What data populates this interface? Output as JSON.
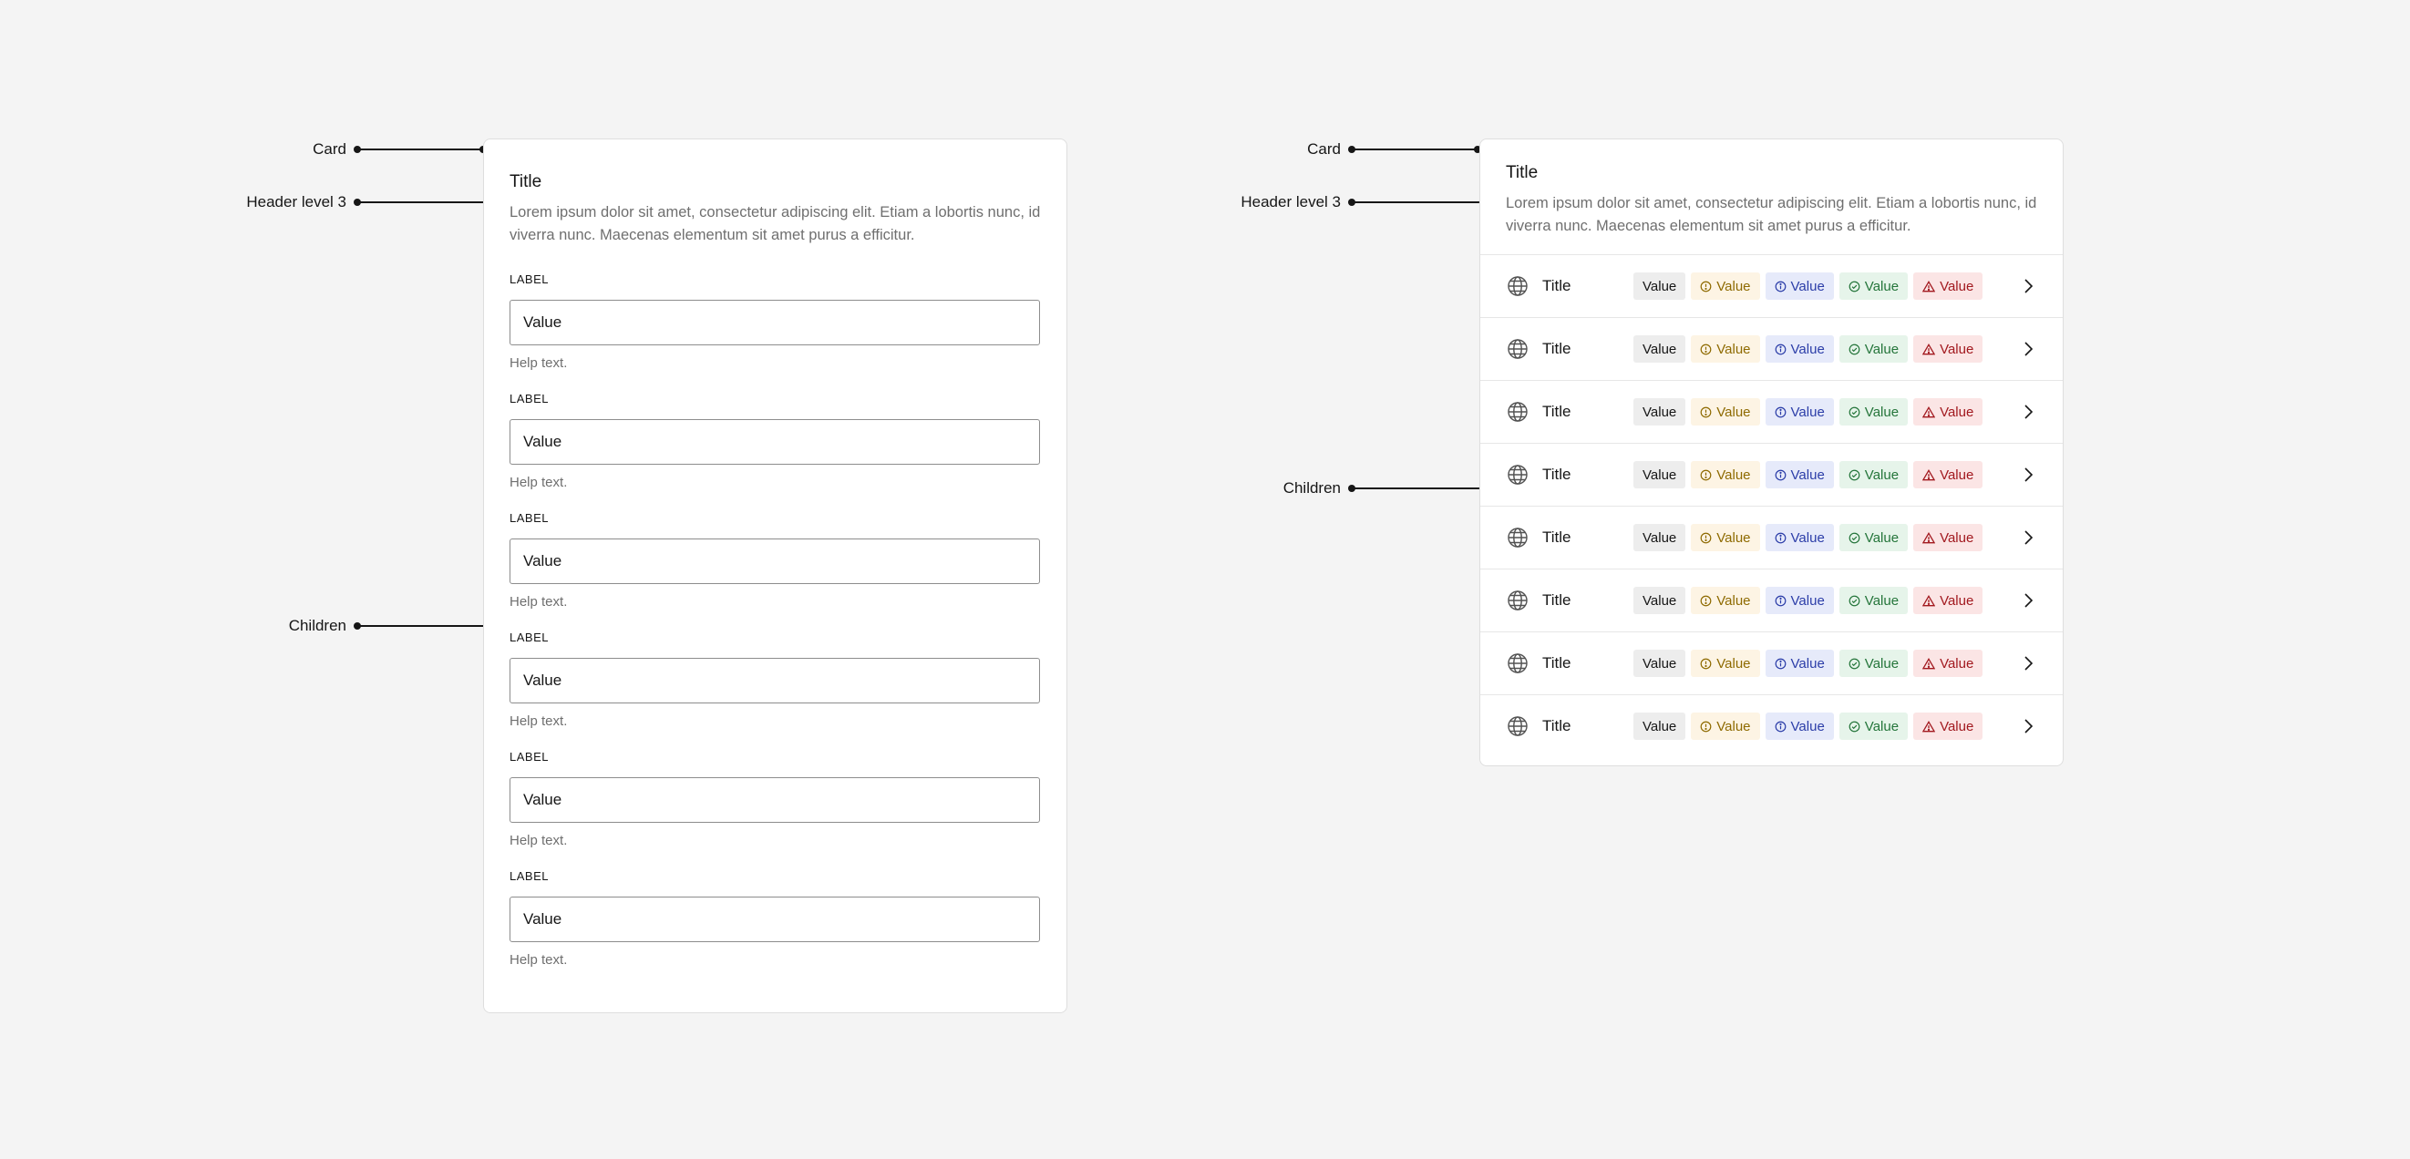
{
  "annotations": {
    "card": "Card",
    "header": "Header level 3",
    "children": "Children"
  },
  "form_card": {
    "title": "Title",
    "description": "Lorem ipsum dolor sit amet, consectetur adipiscing elit. Etiam a lobortis nunc, id viverra nunc. Maecenas elementum sit amet purus a efficitur.",
    "fields": [
      {
        "label": "LABEL",
        "value": "Value",
        "help": "Help text."
      },
      {
        "label": "LABEL",
        "value": "Value",
        "help": "Help text."
      },
      {
        "label": "LABEL",
        "value": "Value",
        "help": "Help text."
      },
      {
        "label": "LABEL",
        "value": "Value",
        "help": "Help text."
      },
      {
        "label": "LABEL",
        "value": "Value",
        "help": "Help text."
      },
      {
        "label": "LABEL",
        "value": "Value",
        "help": "Help text."
      }
    ]
  },
  "list_card": {
    "title": "Title",
    "description": "Lorem ipsum dolor sit amet, consectetur adipiscing elit. Etiam a lobortis nunc, id viverra nunc. Maecenas elementum sit amet purus a efficitur.",
    "rows": [
      {
        "icon": "globe-icon",
        "title": "Title",
        "tags": [
          "Value",
          "Value",
          "Value",
          "Value",
          "Value"
        ]
      },
      {
        "icon": "globe-icon",
        "title": "Title",
        "tags": [
          "Value",
          "Value",
          "Value",
          "Value",
          "Value"
        ]
      },
      {
        "icon": "globe-icon",
        "title": "Title",
        "tags": [
          "Value",
          "Value",
          "Value",
          "Value",
          "Value"
        ]
      },
      {
        "icon": "globe-icon",
        "title": "Title",
        "tags": [
          "Value",
          "Value",
          "Value",
          "Value",
          "Value"
        ]
      },
      {
        "icon": "globe-icon",
        "title": "Title",
        "tags": [
          "Value",
          "Value",
          "Value",
          "Value",
          "Value"
        ]
      },
      {
        "icon": "globe-icon",
        "title": "Title",
        "tags": [
          "Value",
          "Value",
          "Value",
          "Value",
          "Value"
        ]
      },
      {
        "icon": "globe-icon",
        "title": "Title",
        "tags": [
          "Value",
          "Value",
          "Value",
          "Value",
          "Value"
        ]
      },
      {
        "icon": "globe-icon",
        "title": "Title",
        "tags": [
          "Value",
          "Value",
          "Value",
          "Value",
          "Value"
        ]
      }
    ],
    "tag_kinds": [
      {
        "kind": "neutral",
        "icon": null,
        "color": "#161616",
        "background": "#ededed"
      },
      {
        "kind": "warning",
        "icon": "clock-icon",
        "color": "#8e6a00",
        "background": "#fdf4e4"
      },
      {
        "kind": "info",
        "icon": "info-icon",
        "color": "#2b3da8",
        "background": "#e6eafa"
      },
      {
        "kind": "success",
        "icon": "check-circle-icon",
        "color": "#24753a",
        "background": "#e6f4ea"
      },
      {
        "kind": "error",
        "icon": "warning-triangle-icon",
        "color": "#a2191f",
        "background": "#fbe5e5"
      }
    ]
  }
}
